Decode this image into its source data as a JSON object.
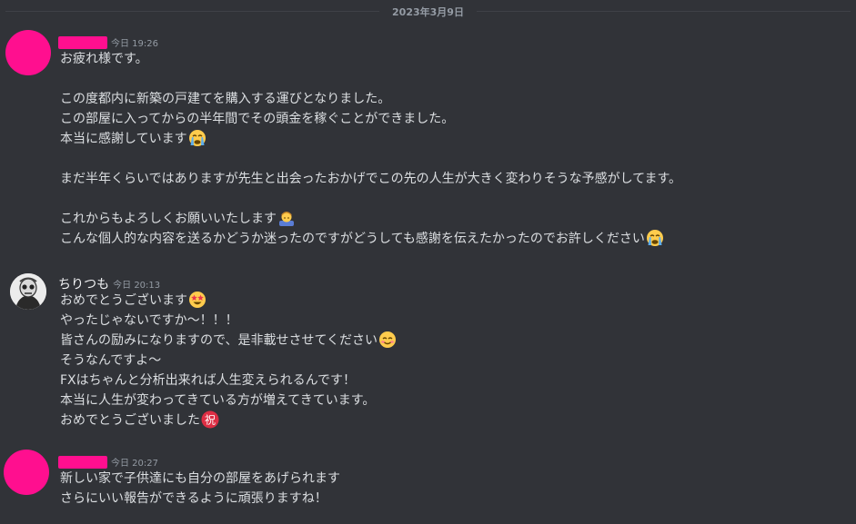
{
  "date_divider": "2023年3月9日",
  "messages": [
    {
      "author": "",
      "time": "今日 19:26",
      "avatar_color": "#ff0f8f",
      "lines": [
        "お疲れ様です。",
        "",
        "この度都内に新築の戸建てを購入する運びとなりました。",
        "この部屋に入ってからの半年間でその頭金を稼ぐことができました。",
        "本当に感謝しています",
        "",
        "まだ半年くらいではありますが先生と出会ったおかげでこの先の人生が大きく変わりそうな予感がしてます。",
        "",
        "これからもよろしくお願いいたします",
        "こんな個人的な内容を送るかどうか迷ったのですがどうしても感謝を伝えたかったのでお許しください"
      ],
      "emojis": {
        "4": "crying-face-icon",
        "8": "bowing-person-icon",
        "9": "crying-face-icon"
      }
    },
    {
      "author": "ちりつも",
      "time": "今日 20:13",
      "avatar_icon": "skull-character-avatar",
      "lines": [
        "おめでとうございます",
        "やったじゃないですか～！！！",
        "皆さんの励みになりますので、是非載せさせてください",
        "そうなんですよ～",
        "FXはちゃんと分析出来れば人生変えられるんです！",
        "本当に人生が変わってきている方が増えてきています。",
        "おめでとうございました"
      ],
      "emojis": {
        "0": "star-struck-icon",
        "2": "smiling-face-icon",
        "6": "congratulations-ideograph-icon"
      }
    },
    {
      "author": "",
      "time": "今日 20:27",
      "avatar_color": "#ff0f8f",
      "lines": [
        "新しい家で子供達にも自分の部屋をあげられます",
        "さらにいい報告ができるように頑張りますね！"
      ]
    }
  ],
  "emoji_text": {
    "congratulations": "祝"
  },
  "colors": {
    "background": "#313338",
    "redaction": "#ff0f8f",
    "text": "#dbdee1",
    "muted": "#949ba4"
  }
}
